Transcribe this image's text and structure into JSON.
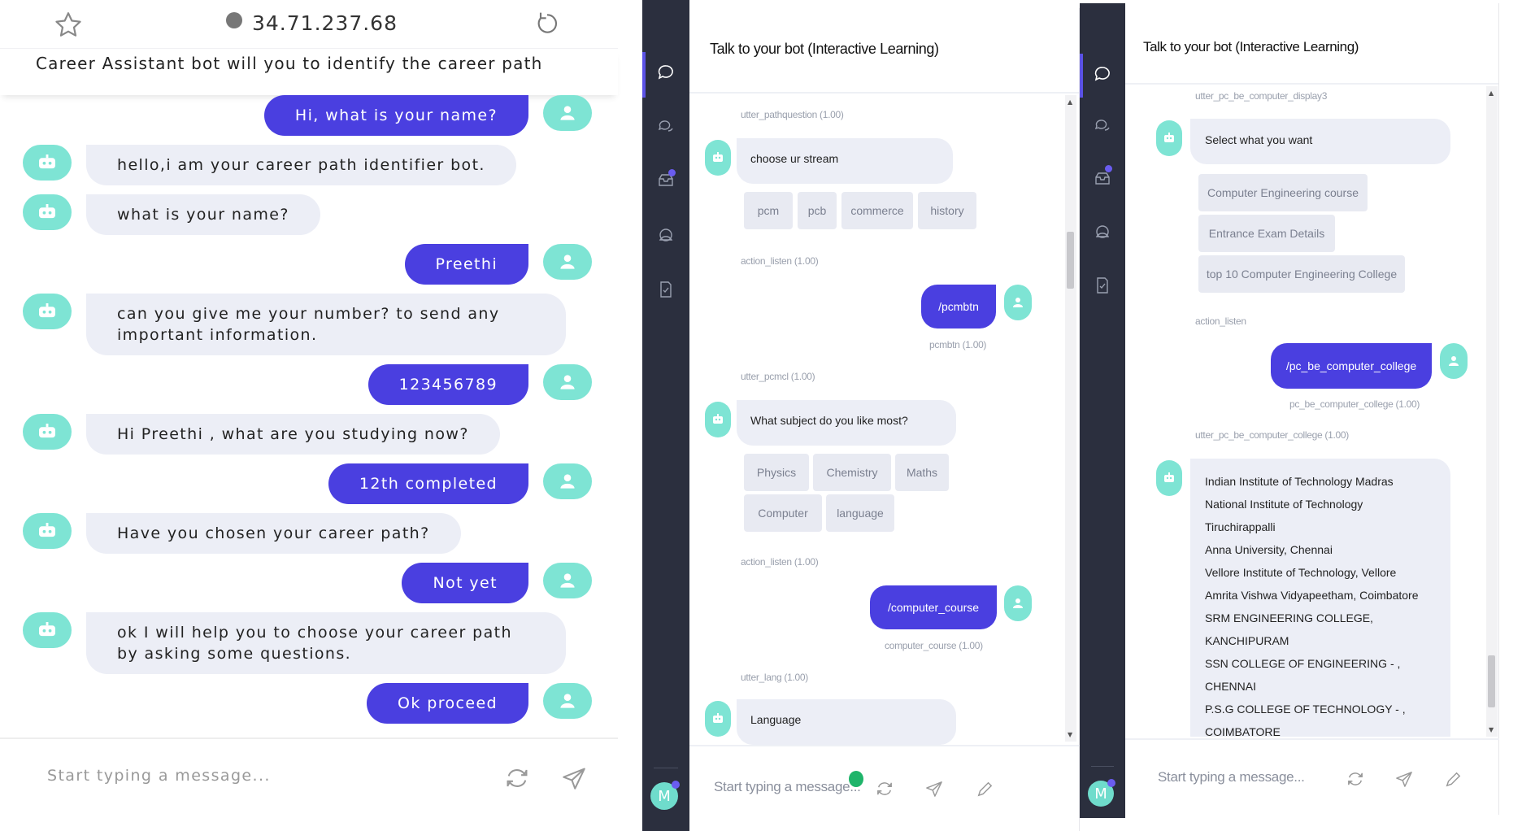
{
  "panel1": {
    "address": "34.71.237.68",
    "subtitle": "Career Assistant bot will you to identify the career path",
    "messages": [
      {
        "from": "user",
        "text": "Hi, what is your name?"
      },
      {
        "from": "bot",
        "text": "hello,i am your career path identifier bot."
      },
      {
        "from": "bot",
        "text": "what is your name?"
      },
      {
        "from": "user",
        "text": "Preethi"
      },
      {
        "from": "bot",
        "text": "can you give me your number? to send any important information."
      },
      {
        "from": "user",
        "text": "123456789"
      },
      {
        "from": "bot",
        "text": "Hi Preethi , what are you studying now?"
      },
      {
        "from": "user",
        "text": "12th completed"
      },
      {
        "from": "bot",
        "text": "Have you chosen your career path?"
      },
      {
        "from": "user",
        "text": "Not yet"
      },
      {
        "from": "bot",
        "text": "ok I will help you to choose your career path by asking some questions."
      },
      {
        "from": "user",
        "text": "Ok proceed"
      }
    ],
    "composer_placeholder": "Start typing a message..."
  },
  "panel2": {
    "header": "Talk to your bot (Interactive Learning)",
    "meta1": "utter_pathquestion (1.00)",
    "bot1": "choose ur stream",
    "chips1": [
      "pcm",
      "pcb",
      "commerce",
      "history"
    ],
    "meta2": "action_listen (1.00)",
    "user1": "/pcmbtn",
    "user1_intent": "pcmbtn (1.00)",
    "meta3": "utter_pcmcl (1.00)",
    "bot2": "What subject do you like most?",
    "chips2a": [
      "Physics",
      "Chemistry",
      "Maths"
    ],
    "chips2b": [
      "Computer",
      "language"
    ],
    "meta4": "action_listen (1.00)",
    "user2": "/computer_course",
    "user2_intent": "computer_course (1.00)",
    "meta5": "utter_lang (1.00)",
    "bot3": "Language",
    "composer_placeholder": "Start typing a message...",
    "avatar_letter": "M"
  },
  "panel3": {
    "header": "Talk to your bot (Interactive Learning)",
    "meta1": "utter_pc_be_computer_display3",
    "bot1": "Select what you want",
    "chips": [
      "Computer Engineering course",
      "Entrance Exam Details",
      "top 10 Computer Engineering College"
    ],
    "meta2": "action_listen",
    "user1": "/pc_be_computer_college",
    "user1_intent": "pc_be_computer_college (1.00)",
    "meta3": "utter_pc_be_computer_college (1.00)",
    "colleges": [
      "Indian Institute of Technology Madras",
      "National Institute of Technology",
      "Tiruchirappalli",
      "Anna University, Chennai",
      "Vellore Institute of Technology, Vellore",
      "Amrita Vishwa Vidyapeetham, Coimbatore",
      "SRM ENGINEERING COLLEGE,",
      "KANCHIPURAM",
      "SSN COLLEGE OF ENGINEERING - ,",
      "CHENNAI",
      "P.S.G COLLEGE OF TECHNOLOGY - ,",
      "COIMBATORE"
    ],
    "composer_placeholder": "Start typing a message...",
    "avatar_letter": "M"
  },
  "colors": {
    "user_bubble": "#4a3fe0",
    "bot_bubble": "#eceef6",
    "avatar": "#7ee4d4",
    "sidebar": "#2b2f3e"
  }
}
